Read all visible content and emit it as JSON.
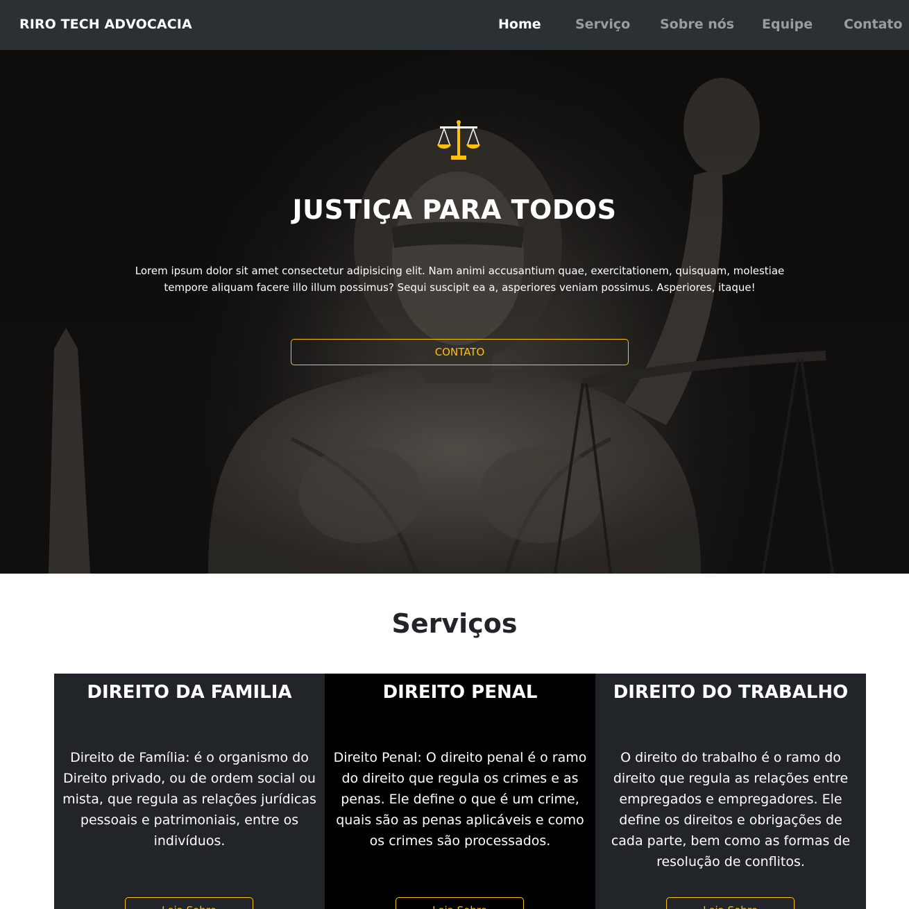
{
  "nav": {
    "brand": "RIRO TECH ADVOCACIA",
    "links": [
      "Home",
      "Serviço",
      "Sobre nós",
      "Equipe",
      "Contato"
    ],
    "active": "Home"
  },
  "hero": {
    "icon": "scales-of-justice-icon",
    "title": "JUSTIÇA PARA TODOS",
    "text": "Lorem ipsum dolor sit amet consectetur adipisicing elit. Nam animi accusantium quae, exercitationem, quisquam, molestiae tempore aliquam facere illo illum possimus? Sequi suscipit ea a, asperiores veniam possimus. Asperiores, itaque!",
    "button": "CONTATO"
  },
  "services": {
    "title": "Serviços",
    "cards": [
      {
        "title": "DIREITO DA FAMILIA",
        "text": "Direito de Família: é o organismo do Direito privado, ou de ordem social ou mista, que regula as relações jurídicas pessoais e patrimoniais, entre os indivíduos.",
        "button": "Leia Sobre"
      },
      {
        "title": "DIREITO PENAL",
        "text": "Direito Penal: O direito penal é o ramo do direito que regula os crimes e as penas. Ele define o que é um crime, quais são as penas aplicáveis e como os crimes são processados.",
        "button": "Leia Sobre"
      },
      {
        "title": "DIREITO DO TRABALHO",
        "text": "O direito do trabalho é o ramo do direito que regula as relações entre empregados e empregadores. Ele define os direitos e obrigações de cada parte, bem como as formas de resolução de conflitos.",
        "button": "Leia Sobre"
      }
    ]
  },
  "colors": {
    "navbar": "#2b3035",
    "accent": "#ffc107",
    "card_dark": "#212529",
    "card_black": "#000000"
  }
}
